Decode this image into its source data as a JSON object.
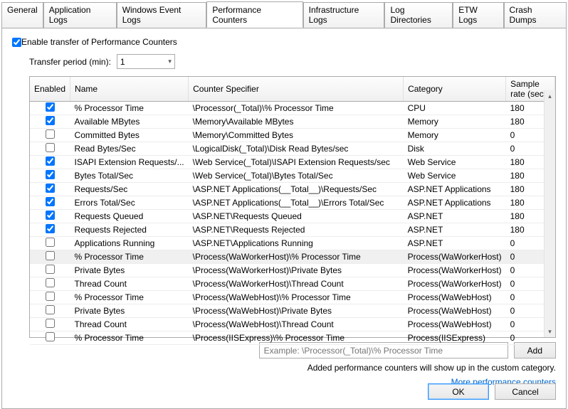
{
  "tabs": [
    "General",
    "Application Logs",
    "Windows Event Logs",
    "Performance Counters",
    "Infrastructure Logs",
    "Log Directories",
    "ETW Logs",
    "Crash Dumps"
  ],
  "activeTab": 3,
  "enable": {
    "checked": true,
    "label": "Enable transfer of Performance Counters"
  },
  "transfer": {
    "label": "Transfer period (min):",
    "value": "1"
  },
  "columns": {
    "enabled": "Enabled",
    "name": "Name",
    "spec": "Counter Specifier",
    "cat": "Category",
    "rate": "Sample rate (sec)"
  },
  "rows": [
    {
      "on": true,
      "name": "% Processor Time",
      "spec": "\\Processor(_Total)\\% Processor Time",
      "cat": "CPU",
      "rate": "180"
    },
    {
      "on": true,
      "name": "Available MBytes",
      "spec": "\\Memory\\Available MBytes",
      "cat": "Memory",
      "rate": "180"
    },
    {
      "on": false,
      "name": "Committed Bytes",
      "spec": "\\Memory\\Committed Bytes",
      "cat": "Memory",
      "rate": "0"
    },
    {
      "on": false,
      "name": "Read Bytes/Sec",
      "spec": "\\LogicalDisk(_Total)\\Disk Read Bytes/sec",
      "cat": "Disk",
      "rate": "0"
    },
    {
      "on": true,
      "name": "ISAPI Extension Requests/...",
      "spec": "\\Web Service(_Total)\\ISAPI Extension Requests/sec",
      "cat": "Web Service",
      "rate": "180"
    },
    {
      "on": true,
      "name": "Bytes Total/Sec",
      "spec": "\\Web Service(_Total)\\Bytes Total/Sec",
      "cat": "Web Service",
      "rate": "180"
    },
    {
      "on": true,
      "name": "Requests/Sec",
      "spec": "\\ASP.NET Applications(__Total__)\\Requests/Sec",
      "cat": "ASP.NET Applications",
      "rate": "180"
    },
    {
      "on": true,
      "name": "Errors Total/Sec",
      "spec": "\\ASP.NET Applications(__Total__)\\Errors Total/Sec",
      "cat": "ASP.NET Applications",
      "rate": "180"
    },
    {
      "on": true,
      "name": "Requests Queued",
      "spec": "\\ASP.NET\\Requests Queued",
      "cat": "ASP.NET",
      "rate": "180"
    },
    {
      "on": true,
      "name": "Requests Rejected",
      "spec": "\\ASP.NET\\Requests Rejected",
      "cat": "ASP.NET",
      "rate": "180"
    },
    {
      "on": false,
      "name": "Applications Running",
      "spec": "\\ASP.NET\\Applications Running",
      "cat": "ASP.NET",
      "rate": "0"
    },
    {
      "on": false,
      "name": "% Processor Time",
      "spec": "\\Process(WaWorkerHost)\\% Processor Time",
      "cat": "Process(WaWorkerHost)",
      "rate": "0",
      "sel": true
    },
    {
      "on": false,
      "name": "Private Bytes",
      "spec": "\\Process(WaWorkerHost)\\Private Bytes",
      "cat": "Process(WaWorkerHost)",
      "rate": "0"
    },
    {
      "on": false,
      "name": "Thread Count",
      "spec": "\\Process(WaWorkerHost)\\Thread Count",
      "cat": "Process(WaWorkerHost)",
      "rate": "0"
    },
    {
      "on": false,
      "name": "% Processor Time",
      "spec": "\\Process(WaWebHost)\\% Processor Time",
      "cat": "Process(WaWebHost)",
      "rate": "0"
    },
    {
      "on": false,
      "name": "Private Bytes",
      "spec": "\\Process(WaWebHost)\\Private Bytes",
      "cat": "Process(WaWebHost)",
      "rate": "0"
    },
    {
      "on": false,
      "name": "Thread Count",
      "spec": "\\Process(WaWebHost)\\Thread Count",
      "cat": "Process(WaWebHost)",
      "rate": "0"
    },
    {
      "on": false,
      "name": "% Processor Time",
      "spec": "\\Process(IISExpress)\\% Processor Time",
      "cat": "Process(IISExpress)",
      "rate": "0"
    }
  ],
  "addRow": {
    "placeholder": "Example: \\Processor(_Total)\\% Processor Time",
    "button": "Add"
  },
  "hint": "Added performance counters will show up in the custom category.",
  "link": "More performance counters",
  "footer": {
    "ok": "OK",
    "cancel": "Cancel"
  }
}
